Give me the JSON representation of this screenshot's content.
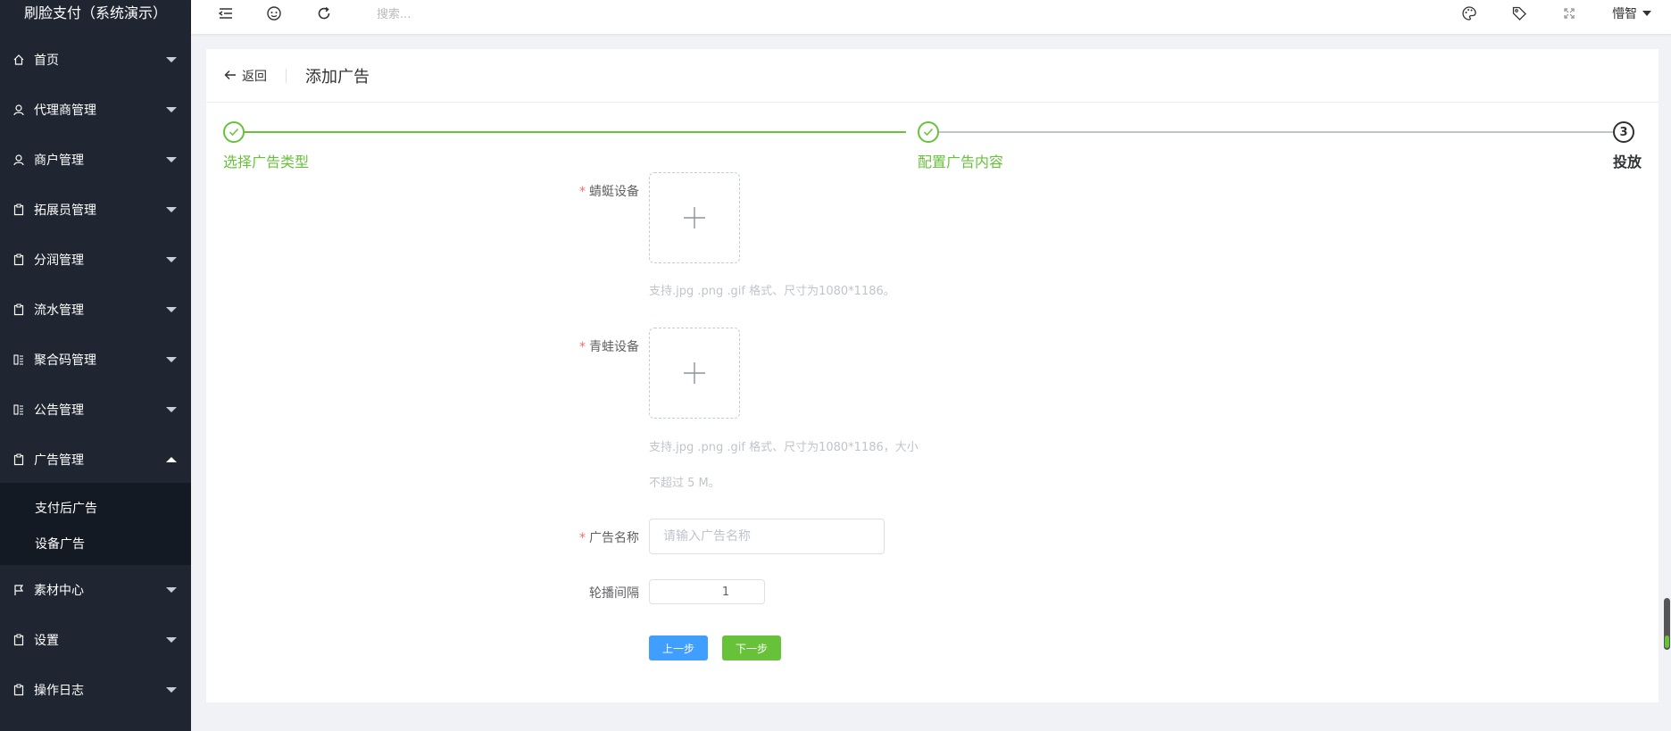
{
  "sidebar": {
    "brand": "刷脸支付（系统演示）",
    "items": [
      {
        "label": "首页",
        "icon": "home-icon"
      },
      {
        "label": "代理商管理",
        "icon": "user-icon"
      },
      {
        "label": "商户管理",
        "icon": "user-icon"
      },
      {
        "label": "拓展员管理",
        "icon": "clipboard-icon"
      },
      {
        "label": "分润管理",
        "icon": "clipboard-icon"
      },
      {
        "label": "流水管理",
        "icon": "clipboard-icon"
      },
      {
        "label": "聚合码管理",
        "icon": "list-icon"
      },
      {
        "label": "公告管理",
        "icon": "list-icon"
      },
      {
        "label": "广告管理",
        "icon": "clipboard-icon",
        "expanded": true
      },
      {
        "label": "素材中心",
        "icon": "flag-icon"
      },
      {
        "label": "设置",
        "icon": "clipboard-icon"
      },
      {
        "label": "操作日志",
        "icon": "clipboard-icon"
      }
    ],
    "submenu": [
      "支付后广告",
      "设备广告"
    ]
  },
  "topbar": {
    "search_placeholder": "搜索...",
    "user": "懵智"
  },
  "page": {
    "back_label": "返回",
    "title": "添加广告"
  },
  "steps": [
    {
      "title": "选择广告类型",
      "status": "done"
    },
    {
      "title": "配置广告内容",
      "status": "done"
    },
    {
      "title": "投放",
      "status": "current",
      "number": "3"
    }
  ],
  "form": {
    "dragonfly_label": "蜻蜓设备",
    "dragonfly_tip": "支持.jpg .png .gif 格式、尺寸为1080*1186。",
    "frog_label": "青蛙设备",
    "frog_tip_line1": "支持.jpg .png .gif 格式、尺寸为1080*1186，大小",
    "frog_tip_line2": "不超过 5 M。",
    "name_label": "广告名称",
    "name_placeholder": "请输入广告名称",
    "interval_label": "轮播间隔",
    "interval_value": "1",
    "prev_label": "上一步",
    "next_label": "下一步"
  },
  "colors": {
    "sidebar_bg": "#1f2631",
    "success": "#67c23a",
    "primary": "#409eff",
    "required": "#f56c6c"
  }
}
